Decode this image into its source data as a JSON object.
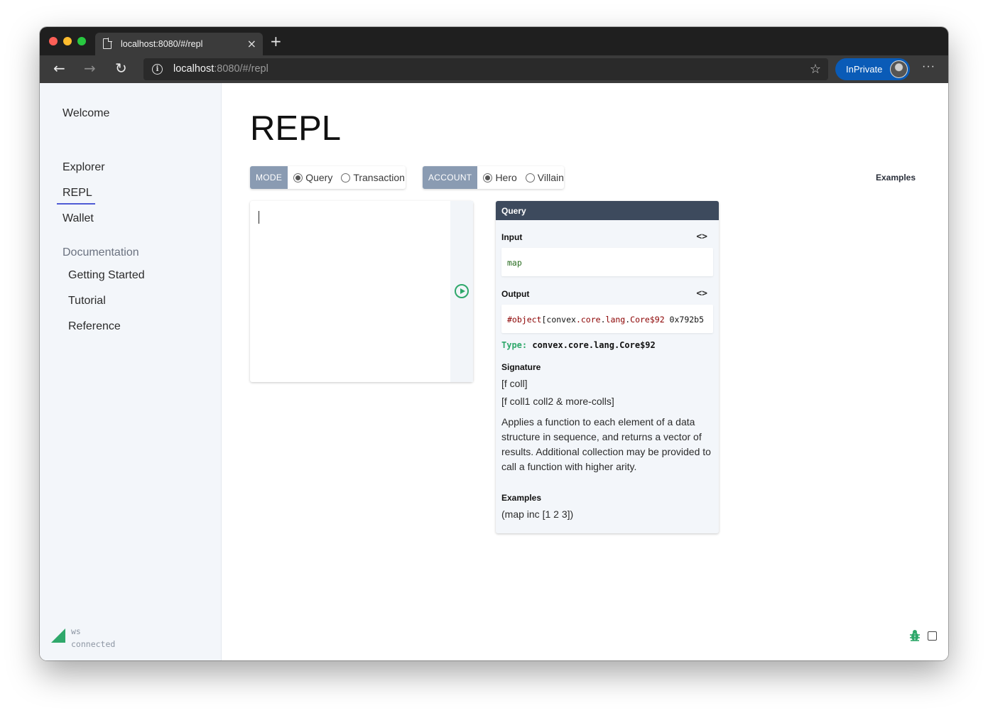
{
  "browser": {
    "tab_title": "localhost:8080/#/repl",
    "tab_close": "×",
    "new_tab": "+",
    "url_host": "localhost",
    "url_rest": ":8080/#/repl",
    "inprivate_label": "InPrivate",
    "more": "···",
    "back": "←",
    "forward": "→",
    "reload": "↻",
    "star": "☆",
    "info": "i"
  },
  "sidebar": {
    "welcome": "Welcome",
    "explorer": "Explorer",
    "repl": "REPL",
    "wallet": "Wallet",
    "documentation": "Documentation",
    "getting_started": "Getting Started",
    "tutorial": "Tutorial",
    "reference": "Reference",
    "ws_label": "ws",
    "ws_status": "connected",
    "ws_color": "#2fa86b"
  },
  "main": {
    "title": "REPL",
    "mode_tag": "MODE",
    "mode_options": [
      "Query",
      "Transaction"
    ],
    "mode_selected": "Query",
    "account_tag": "ACCOUNT",
    "account_options": [
      "Hero",
      "Villain"
    ],
    "account_selected": "Hero",
    "examples_link": "Examples",
    "editor_value": ""
  },
  "result": {
    "header": "Query",
    "input_label": "Input",
    "input_code": "map",
    "output_label": "Output",
    "output_tokens": [
      "#object",
      "[convex",
      ".",
      "core",
      ".",
      "lang",
      ".",
      "Core$92",
      " 0x792b5"
    ],
    "type_key": "Type:",
    "type_value": "convex.core.lang.Core$92",
    "signature_label": "Signature",
    "signatures": [
      "[f coll]",
      "[f coll1 coll2 & more-colls]"
    ],
    "description": "Applies a function to each element of a data structure in sequence, and returns a vector of results. Additional collection may be provided to call a function with higher arity.",
    "examples_label": "Examples",
    "example": "(map inc [1 2 3])",
    "code_toggle": "<>"
  },
  "colors": {
    "accent_green": "#2fa86b",
    "header_dark": "#3d4a5d",
    "tag_bg": "#8a9bb2",
    "nav_active": "#4f5bd5"
  }
}
